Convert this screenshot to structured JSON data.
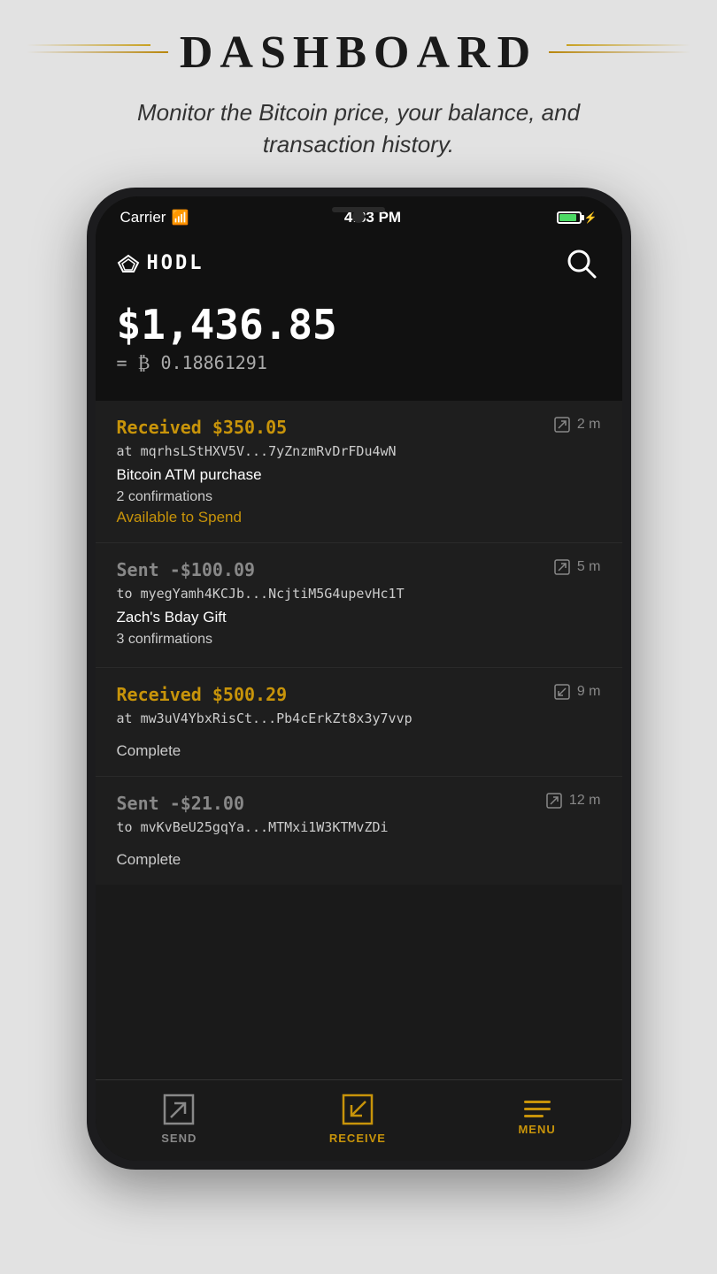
{
  "header": {
    "title": "DASHBOARD",
    "subtitle": "Monitor the Bitcoin price, your balance, and transaction history."
  },
  "status_bar": {
    "carrier": "Carrier",
    "time": "4:33 PM"
  },
  "app": {
    "logo_text": "HODL"
  },
  "balance": {
    "usd": "$1,436.85",
    "btc_prefix": "= ₿",
    "btc_value": "0.18861291"
  },
  "transactions": [
    {
      "type": "received",
      "amount": "Received $350.05",
      "address": "at mqrhsLStHXV5V...7yZnzmRvDrFDu4wN",
      "time": "2 m",
      "memo": "Bitcoin ATM purchase",
      "confirmations": "2 confirmations",
      "status": "Available to Spend",
      "status_type": "pending"
    },
    {
      "type": "sent",
      "amount": "Sent -$100.09",
      "address": "to myegYamh4KCJb...NcjtiM5G4upevHc1T",
      "time": "5 m",
      "memo": "Zach's Bday Gift",
      "confirmations": "3 confirmations",
      "status": "",
      "status_type": "complete"
    },
    {
      "type": "received",
      "amount": "Received $500.29",
      "address": "at mw3uV4YbxRisCt...Pb4cErkZt8x3y7vvp",
      "time": "9 m",
      "memo": "",
      "confirmations": "",
      "status": "Complete",
      "status_type": "complete"
    },
    {
      "type": "sent",
      "amount": "Sent -$21.00",
      "address": "to mvKvBeU25gqYa...MTMxi1W3KTMvZDi",
      "time": "12 m",
      "memo": "",
      "confirmations": "",
      "status": "Complete",
      "status_type": "complete"
    }
  ],
  "nav": {
    "send_label": "SEND",
    "receive_label": "RECEIVE",
    "menu_label": "MENU"
  }
}
